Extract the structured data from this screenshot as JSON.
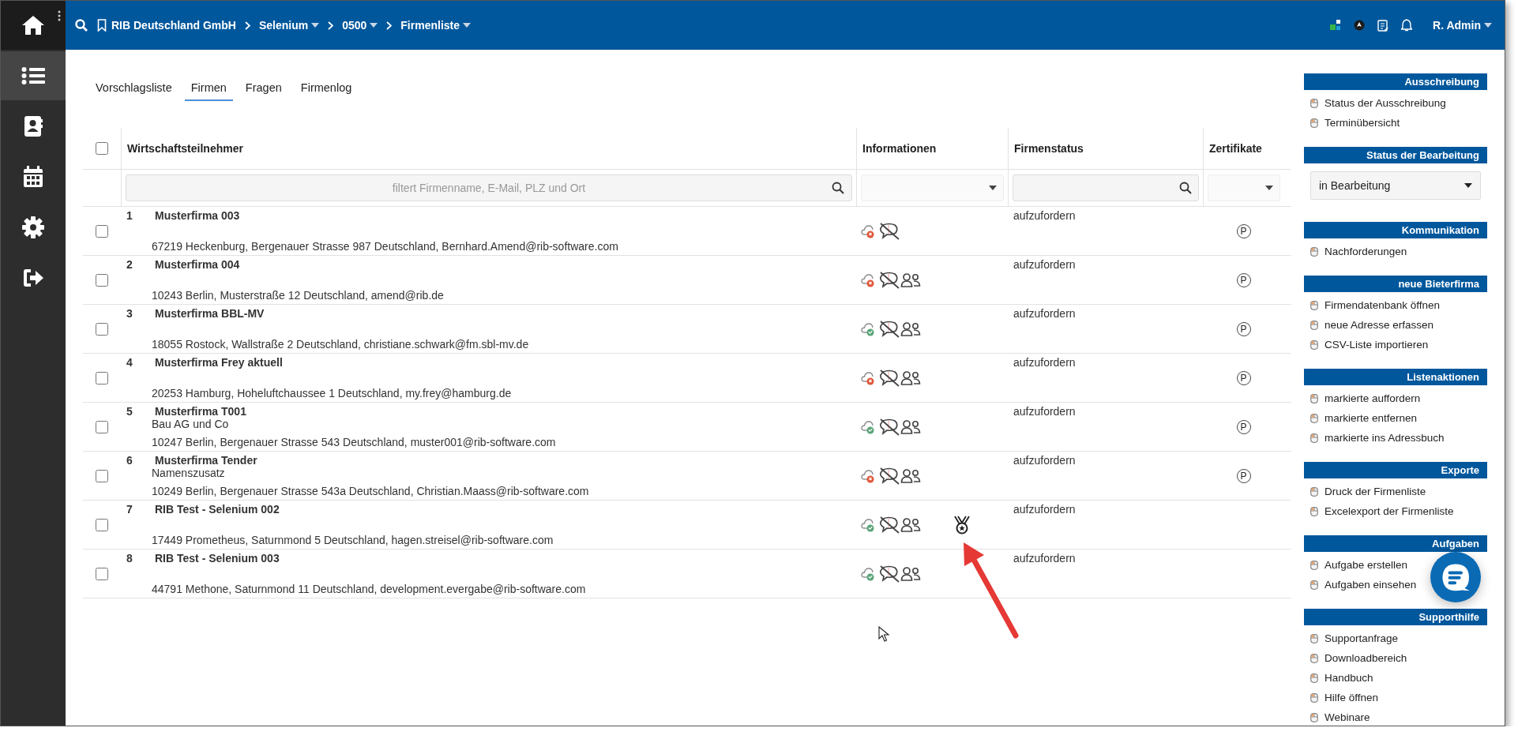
{
  "nav": [
    {
      "kind": "home",
      "selected": false
    },
    {
      "kind": "list",
      "selected": true
    },
    {
      "kind": "contacts",
      "selected": false
    },
    {
      "kind": "calendar",
      "selected": false
    },
    {
      "kind": "settings",
      "selected": false
    },
    {
      "kind": "logout",
      "selected": false
    }
  ],
  "breadcrumb": [
    {
      "label": "RIB Deutschland GmbH",
      "dropdown": false
    },
    {
      "label": "Selenium",
      "dropdown": true
    },
    {
      "label": "0500",
      "dropdown": true
    },
    {
      "label": "Firmenliste",
      "dropdown": true
    }
  ],
  "user": "R. Admin",
  "tabs": [
    {
      "label": "Vorschlagsliste",
      "selected": false
    },
    {
      "label": "Firmen",
      "selected": true
    },
    {
      "label": "Fragen",
      "selected": false
    },
    {
      "label": "Firmenlog",
      "selected": false
    }
  ],
  "table": {
    "columns": [
      "Wirtschaftsteilnehmer",
      "Informationen",
      "Firmenstatus",
      "Zertifikate"
    ],
    "select_all_checked": false,
    "filter_placeholder": "filtert Firmenname, E-Mail, PLZ und Ort",
    "rows": [
      {
        "number": "1",
        "name": "Musterfirma 003",
        "address": "67219 Heckenburg, Bergenauer Strasse 987 Deutschland, Bernhard.Amend@rib-software.com",
        "cloud_ok": false,
        "contacts": false,
        "medal": false,
        "status": "aufzufordern",
        "certificate": "P",
        "checked": false
      },
      {
        "number": "2",
        "name": "Musterfirma 004",
        "address": "10243 Berlin, Musterstraße 12 Deutschland, amend@rib.de",
        "cloud_ok": false,
        "contacts": true,
        "medal": false,
        "status": "aufzufordern",
        "certificate": "P",
        "checked": false
      },
      {
        "number": "3",
        "name": "Musterfirma BBL-MV",
        "address": "18055 Rostock, Wallstraße 2 Deutschland, christiane.schwark@fm.sbl-mv.de",
        "cloud_ok": true,
        "contacts": true,
        "medal": false,
        "status": "aufzufordern",
        "certificate": "P",
        "checked": false
      },
      {
        "number": "4",
        "name": "Musterfirma Frey aktuell",
        "address": "20253 Hamburg, Hoheluftchaussee 1 Deutschland, my.frey@hamburg.de",
        "cloud_ok": false,
        "contacts": true,
        "medal": false,
        "status": "aufzufordern",
        "certificate": "P",
        "checked": false
      },
      {
        "number": "5",
        "name": "Musterfirma T001",
        "extra": "Bau AG und Co",
        "address": "10247 Berlin, Bergenauer Strasse 543 Deutschland, muster001@rib-software.com",
        "cloud_ok": true,
        "contacts": true,
        "medal": false,
        "status": "aufzufordern",
        "certificate": "P",
        "checked": false
      },
      {
        "number": "6",
        "name": "Musterfirma Tender",
        "extra": "Namenszusatz",
        "address": "10249 Berlin, Bergenauer Strasse 543a Deutschland, Christian.Maass@rib-software.com",
        "cloud_ok": false,
        "contacts": true,
        "medal": false,
        "status": "aufzufordern",
        "certificate": "P",
        "checked": false
      },
      {
        "number": "7",
        "name": "RIB Test - Selenium 002",
        "address": "17449 Prometheus, Saturnmond 5 Deutschland, hagen.streisel@rib-software.com",
        "cloud_ok": true,
        "contacts": true,
        "medal": true,
        "status": "aufzufordern",
        "checked": false
      },
      {
        "number": "8",
        "name": "RIB Test - Selenium 003",
        "address": "44791 Methone, Saturnmond 11 Deutschland, development.evergabe@rib-software.com",
        "cloud_ok": true,
        "contacts": true,
        "medal": false,
        "status": "aufzufordern",
        "checked": false
      }
    ]
  },
  "panel": [
    {
      "kind": "links",
      "title": "Ausschreibung",
      "items": [
        "Status der Ausschreibung",
        "Terminübersicht"
      ]
    },
    {
      "kind": "select",
      "title": "Status der Bearbeitung",
      "value": "in Bearbeitung"
    },
    {
      "kind": "links",
      "title": "Kommunikation",
      "items": [
        "Nachforderungen"
      ]
    },
    {
      "kind": "links",
      "title": "neue Bieterfirma",
      "items": [
        "Firmendatenbank öffnen",
        "neue Adresse erfassen",
        "CSV-Liste importieren"
      ]
    },
    {
      "kind": "links",
      "title": "Listenaktionen",
      "items": [
        "markierte auffordern",
        "markierte entfernen",
        "markierte ins Adressbuch"
      ]
    },
    {
      "kind": "links",
      "title": "Exporte",
      "items": [
        "Druck der Firmenliste",
        "Excelexport der Firmenliste"
      ]
    },
    {
      "kind": "links",
      "title": "Aufgaben",
      "items": [
        "Aufgabe erstellen",
        "Aufgaben einsehen"
      ]
    },
    {
      "kind": "links",
      "title": "Supporthilfe",
      "items": [
        "Supportanfrage",
        "Downloadbereich",
        "Handbuch",
        "Hilfe öffnen",
        "Webinare"
      ]
    }
  ]
}
